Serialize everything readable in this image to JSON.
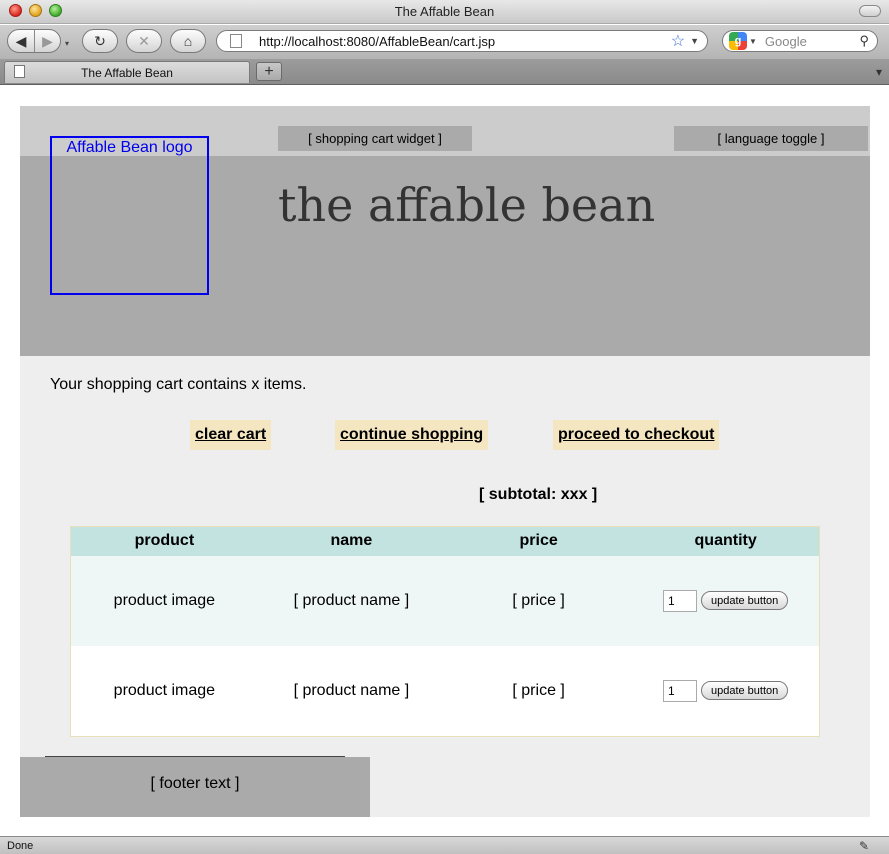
{
  "window": {
    "title": "The Affable Bean"
  },
  "toolbar": {
    "back_glyph": "◀",
    "forward_glyph": "▶",
    "history_glyph": "▾",
    "reload_glyph": "↻",
    "stop_glyph": "✕",
    "home_glyph": "⌂",
    "url": "http://localhost:8080/AffableBean/cart.jsp",
    "star_glyph": "☆",
    "url_dropdown_glyph": "▼",
    "search_engine_glyph": "g",
    "search_dropdown_glyph": "▼",
    "search_placeholder": "Google",
    "search_glyph": "⚲"
  },
  "tabs": {
    "active_label": "The Affable Bean",
    "new_tab_glyph": "+",
    "tab_list_glyph": "▾"
  },
  "header": {
    "logo_text": "Affable Bean logo",
    "cart_widget": "[ shopping cart widget ]",
    "language_toggle": "[ language toggle ]",
    "site_title": "the affable bean"
  },
  "cart": {
    "summary": "Your shopping cart contains x items.",
    "actions": {
      "clear": "clear cart",
      "continue": "continue shopping",
      "checkout": "proceed to checkout"
    },
    "subtotal": "[ subtotal: xxx ]",
    "columns": [
      "product",
      "name",
      "price",
      "quantity"
    ],
    "rows": [
      {
        "image": "product image",
        "name": "[ product name ]",
        "price": "[ price ]",
        "quantity": "1",
        "update_label": "update button"
      },
      {
        "image": "product image",
        "name": "[ product name ]",
        "price": "[ price ]",
        "quantity": "1",
        "update_label": "update button"
      }
    ]
  },
  "footer": {
    "text": "[ footer text ]"
  },
  "status": {
    "text": "Done",
    "icon_glyph": "✎"
  },
  "colors": {
    "header_top": "#cccccc",
    "header_band": "#aaaaaa",
    "page_bg": "#eeeeee",
    "logo_border": "#0000ee",
    "action_bg": "#f5e6c2",
    "table_header": "#c2e3e0",
    "row_light": "#eef7f5"
  }
}
